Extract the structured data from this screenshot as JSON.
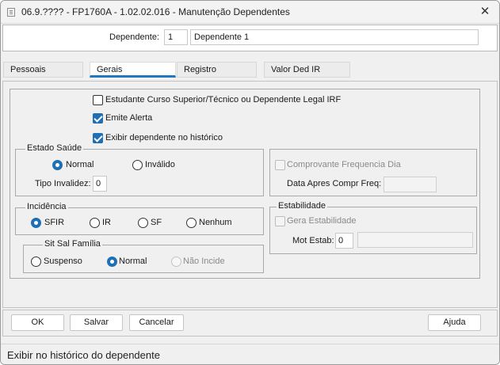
{
  "window": {
    "title": "06.9.???? - FP1760A - 1.02.02.016 - Manutenção Dependentes",
    "close_glyph": "✕"
  },
  "header": {
    "dependente_label": "Dependente:",
    "dependente_number": "1",
    "dependente_name": "Dependente 1"
  },
  "tabs": [
    {
      "label": "Pessoais",
      "active": false
    },
    {
      "label": "Gerais",
      "active": true
    },
    {
      "label": "Registro",
      "active": false
    },
    {
      "label": "Valor Ded IR",
      "active": false
    }
  ],
  "checkboxes": {
    "estudante": {
      "label": "Estudante Curso Superior/Técnico ou Dependente Legal IRF",
      "checked": false
    },
    "emite_alerta": {
      "label": "Emite Alerta",
      "checked": true
    },
    "exibir_historico": {
      "label": "Exibir dependente no histórico",
      "checked": true
    }
  },
  "estado_saude": {
    "title": "Estado Saúde",
    "options": [
      {
        "label": "Normal",
        "selected": true
      },
      {
        "label": "Inválido",
        "selected": false
      }
    ],
    "tipo_invalidez_label": "Tipo Invalidez:",
    "tipo_invalidez_value": "0"
  },
  "comprovante": {
    "checkbox_label": "Comprovante Frequencia Dia",
    "data_label": "Data Apres Compr Freq:",
    "data_value": ""
  },
  "incidencia": {
    "title": "Incidência",
    "options": [
      {
        "label": "SFIR",
        "selected": true
      },
      {
        "label": "IR",
        "selected": false
      },
      {
        "label": "SF",
        "selected": false
      },
      {
        "label": "Nenhum",
        "selected": false
      }
    ]
  },
  "estabilidade": {
    "title": "Estabilidade",
    "checkbox_label": "Gera Estabilidade",
    "mot_label": "Mot Estab:",
    "mot_value": "0",
    "mot_desc": ""
  },
  "sit_sal_familia": {
    "title": "Sit Sal Família",
    "options": [
      {
        "label": "Suspenso",
        "selected": false
      },
      {
        "label": "Normal",
        "selected": true
      },
      {
        "label": "Não Incide",
        "selected": false,
        "disabled": true
      }
    ]
  },
  "buttons": {
    "ok": "OK",
    "salvar": "Salvar",
    "cancelar": "Cancelar",
    "ajuda": "Ajuda"
  },
  "status": {
    "text": "Exibir no histórico do dependente"
  },
  "colors": {
    "accent": "#1f6fb5",
    "tab_underline": "#1f78c1"
  }
}
